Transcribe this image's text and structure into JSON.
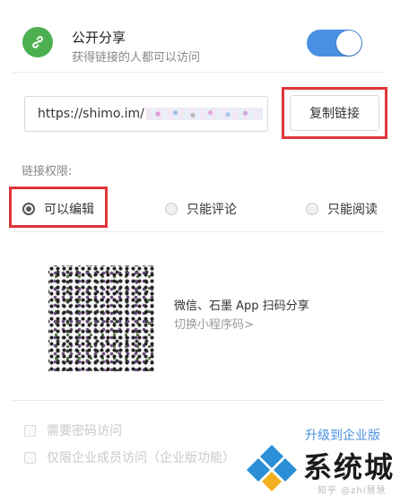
{
  "header": {
    "title": "公开分享",
    "subtitle": "获得链接的人都可以访问",
    "toggle_on": true,
    "colors": {
      "icon_bg": "#4caf50",
      "toggle": "#4a90e2"
    }
  },
  "link": {
    "url_prefix": "https://shimo.im/",
    "copy_label": "复制链接"
  },
  "permissions": {
    "label": "链接权限:",
    "options": [
      {
        "label": "可以编辑",
        "selected": true
      },
      {
        "label": "只能评论",
        "selected": false
      },
      {
        "label": "只能阅读",
        "selected": false
      }
    ]
  },
  "qr": {
    "text": "微信、石墨 App 扫码分享",
    "switch_label": "切换小程序码>"
  },
  "enterprise": {
    "options": [
      {
        "label": "需要密码访问",
        "checked": false
      },
      {
        "label": "仅限企业成员访问（企业版功能）",
        "checked": false
      }
    ],
    "upgrade_label": "升级到企业版"
  },
  "watermark": {
    "text": "系统城",
    "sub": "知乎 @zhi慧慧"
  },
  "colors": {
    "highlight": "#e0353a",
    "link_accent": "#4a90e2"
  }
}
